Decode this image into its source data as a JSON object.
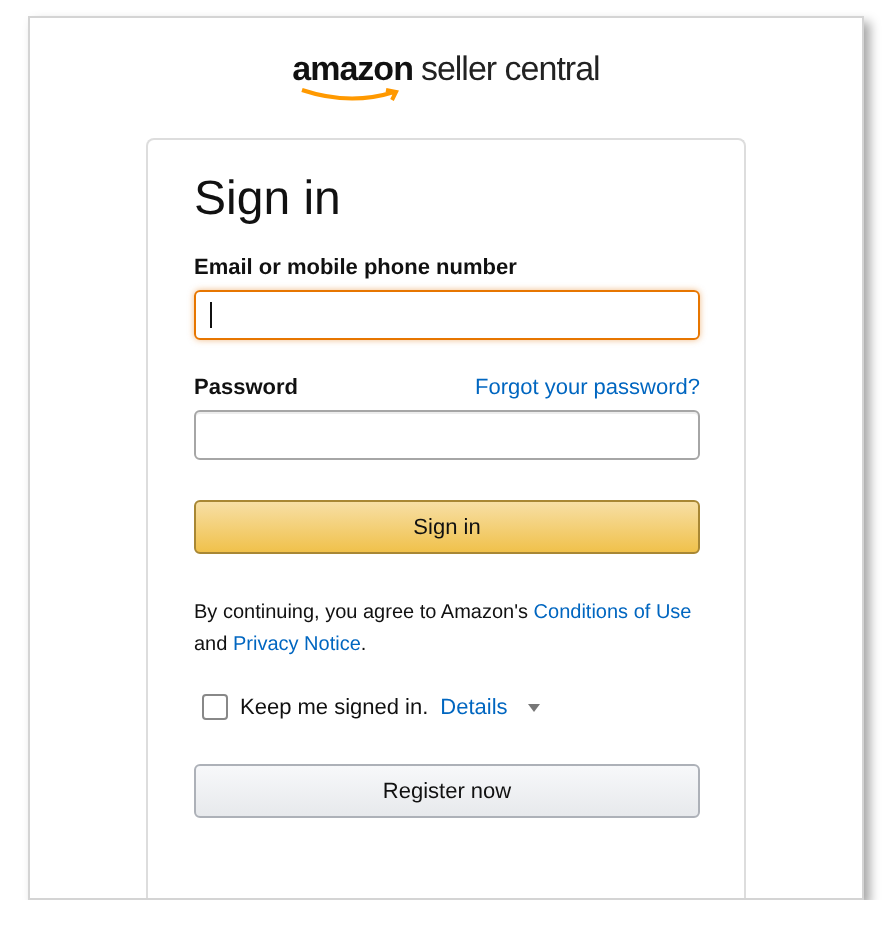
{
  "logo": {
    "brand": "amazon",
    "product": "seller central"
  },
  "title": "Sign in",
  "email": {
    "label": "Email or mobile phone number",
    "focused": true
  },
  "password": {
    "label": "Password",
    "forgot_link": "Forgot your password?"
  },
  "sign_in_button": "Sign in",
  "consent": "By continuing, you agree to Amazon's ",
  "consent_links": [
    "Conditions of Use",
    "Privacy Notice"
  ],
  "consent_and": " and ",
  "consent_end": ".",
  "keep_signed_in": {
    "label": "Keep me signed in.",
    "checked": false,
    "details": "Details"
  },
  "register_button": "Register now"
}
